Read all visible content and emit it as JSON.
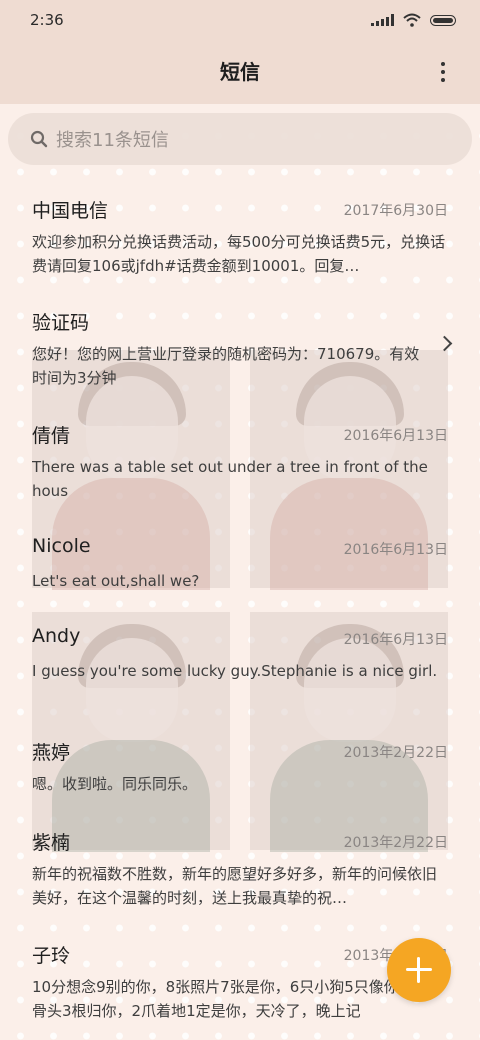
{
  "status_bar": {
    "time": "2:36"
  },
  "header": {
    "title": "短信",
    "more_icon": "more-vert-icon"
  },
  "search": {
    "placeholder": "搜索11条短信",
    "icon": "search-icon"
  },
  "messages": [
    {
      "name": "中国电信",
      "date": "2017年6月30日",
      "preview": "欢迎参加积分兑换话费活动，每500分可兑换话费5元，兑换话费请回复106或jfdh#话费金额到10001。回复…"
    },
    {
      "name": "验证码",
      "date": "",
      "preview": "您好！您的网上营业厅登录的随机密码为：710679。有效时间为3分钟"
    },
    {
      "name": "倩倩",
      "date": "2016年6月13日",
      "preview": "There was a table set out under a tree in front of the hous"
    },
    {
      "name": "Nicole",
      "date": "2016年6月13日",
      "preview": "Let's eat out,shall we?"
    },
    {
      "name": "Andy",
      "date": "2016年6月13日",
      "preview": "I guess you're some lucky guy.Stephanie is a nice girl."
    },
    {
      "name": "燕婷",
      "date": "2013年2月22日",
      "preview": "嗯。收到啦。同乐同乐。"
    },
    {
      "name": "紫楠",
      "date": "2013年2月22日",
      "preview": "新年的祝福数不胜数，新年的愿望好多好多，新年的问候依旧美好，在这个温馨的时刻，送上我最真挚的祝…"
    },
    {
      "name": "子玲",
      "date": "2013年2月22日",
      "preview": "10分想念9别的你，8张照片7张是你，6只小狗5只像你，4根骨头3根归你，2爪着地1定是你，天冷了，晚上记"
    }
  ],
  "fab": {
    "icon": "plus-icon"
  },
  "colors": {
    "accent": "#f5a623",
    "header_bg": "#efdcd2",
    "page_bg": "#fbefe9"
  }
}
